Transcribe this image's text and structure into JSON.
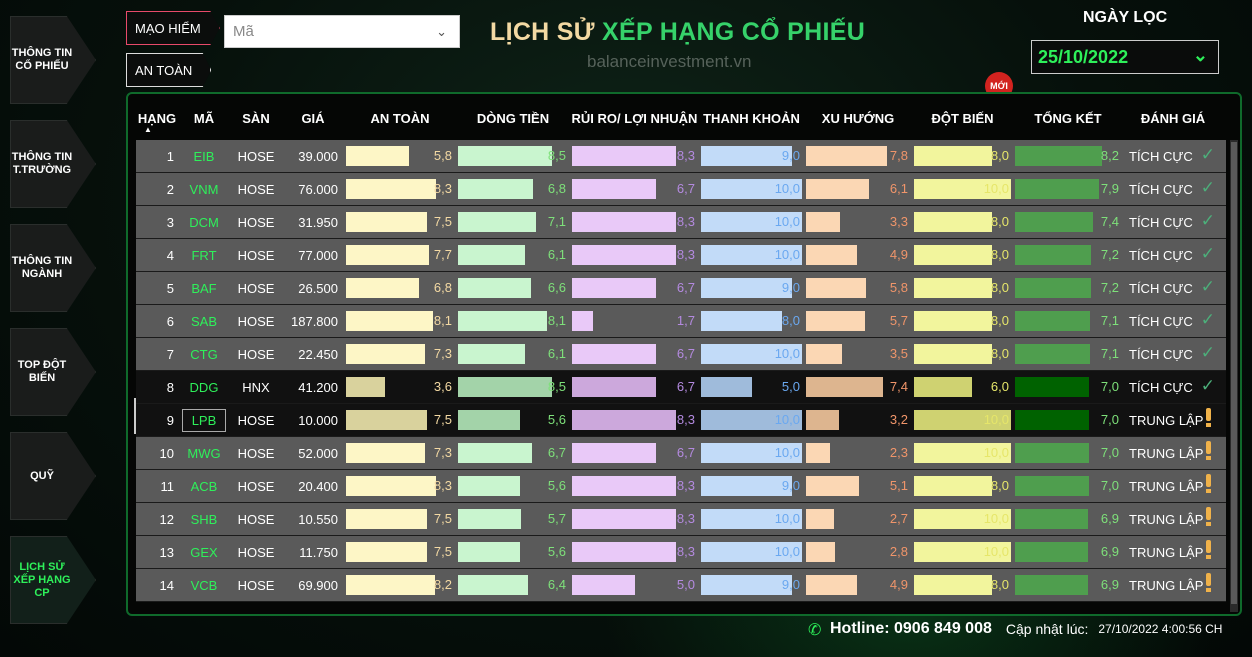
{
  "sidebar": {
    "items": [
      {
        "label": "THÔNG TIN CỔ PHIẾU",
        "active": false
      },
      {
        "label": "THÔNG TIN T.TRƯỜNG",
        "active": false
      },
      {
        "label": "THÔNG TIN NGÀNH",
        "active": false
      },
      {
        "label": "TOP ĐỘT BIẾN",
        "active": false
      },
      {
        "label": "QUỸ",
        "active": false
      },
      {
        "label": "LỊCH SỬ XẾP HẠNG CP",
        "active": true
      }
    ]
  },
  "filters": {
    "risk_chip": "MẠO HIỂM",
    "safe_chip": "AN TOÀN",
    "code_select": {
      "placeholder": "Mã",
      "value": ""
    }
  },
  "header": {
    "title_part1": "LỊCH SỬ ",
    "title_part2": "XẾP HẠNG CỔ PHIẾU",
    "watermark": "balanceinvestment.vn",
    "date_label": "NGÀY LỌC",
    "date_value": "25/10/2022",
    "new_badge": "MỚI"
  },
  "table": {
    "headers": {
      "rank": "HẠNG",
      "code": "MÃ",
      "exchange": "SÀN",
      "price": "GIÁ",
      "safety": "AN TOÀN",
      "cashflow": "DÒNG TIỀN",
      "risk_return": "RỦI RO/ LỢI NHUẬN",
      "liquidity": "THANH KHOẢN",
      "trend": "XU HƯỚNG",
      "breakout": "ĐỘT BIẾN",
      "total": "TỔNG KẾT",
      "rating": "ĐÁNH GIÁ"
    },
    "rows": [
      {
        "rank": "1",
        "code": "EIB",
        "exchange": "HOSE",
        "price": "39.000",
        "safety": "5,8",
        "cashflow": "8,5",
        "risk_return": "8,3",
        "liquidity": "9,0",
        "trend": "7,8",
        "breakout": "8,0",
        "total": "8,2",
        "rating": "TÍCH CỰC",
        "rating_icon": "check-icon"
      },
      {
        "rank": "2",
        "code": "VNM",
        "exchange": "HOSE",
        "price": "76.000",
        "safety": "8,3",
        "cashflow": "6,8",
        "risk_return": "6,7",
        "liquidity": "10,0",
        "trend": "6,1",
        "breakout": "10,0",
        "total": "7,9",
        "rating": "TÍCH CỰC",
        "rating_icon": "check-icon"
      },
      {
        "rank": "3",
        "code": "DCM",
        "exchange": "HOSE",
        "price": "31.950",
        "safety": "7,5",
        "cashflow": "7,1",
        "risk_return": "8,3",
        "liquidity": "10,0",
        "trend": "3,3",
        "breakout": "8,0",
        "total": "7,4",
        "rating": "TÍCH CỰC",
        "rating_icon": "check-icon"
      },
      {
        "rank": "4",
        "code": "FRT",
        "exchange": "HOSE",
        "price": "77.000",
        "safety": "7,7",
        "cashflow": "6,1",
        "risk_return": "8,3",
        "liquidity": "10,0",
        "trend": "4,9",
        "breakout": "8,0",
        "total": "7,2",
        "rating": "TÍCH CỰC",
        "rating_icon": "check-icon"
      },
      {
        "rank": "5",
        "code": "BAF",
        "exchange": "HOSE",
        "price": "26.500",
        "safety": "6,8",
        "cashflow": "6,6",
        "risk_return": "6,7",
        "liquidity": "9,0",
        "trend": "5,8",
        "breakout": "8,0",
        "total": "7,2",
        "rating": "TÍCH CỰC",
        "rating_icon": "check-icon"
      },
      {
        "rank": "6",
        "code": "SAB",
        "exchange": "HOSE",
        "price": "187.800",
        "safety": "8,1",
        "cashflow": "8,1",
        "risk_return": "1,7",
        "liquidity": "8,0",
        "trend": "5,7",
        "breakout": "8,0",
        "total": "7,1",
        "rating": "TÍCH CỰC",
        "rating_icon": "check-icon"
      },
      {
        "rank": "7",
        "code": "CTG",
        "exchange": "HOSE",
        "price": "22.450",
        "safety": "7,3",
        "cashflow": "6,1",
        "risk_return": "6,7",
        "liquidity": "10,0",
        "trend": "3,5",
        "breakout": "8,0",
        "total": "7,1",
        "rating": "TÍCH CỰC",
        "rating_icon": "check-icon"
      },
      {
        "rank": "8",
        "code": "DDG",
        "exchange": "HNX",
        "price": "41.200",
        "safety": "3,6",
        "cashflow": "8,5",
        "risk_return": "6,7",
        "liquidity": "5,0",
        "trend": "7,4",
        "breakout": "6,0",
        "total": "7,0",
        "rating": "TÍCH CỰC",
        "rating_icon": "check-icon"
      },
      {
        "rank": "9",
        "code": "LPB",
        "exchange": "HOSE",
        "price": "10.000",
        "safety": "7,5",
        "cashflow": "5,6",
        "risk_return": "8,3",
        "liquidity": "10,0",
        "trend": "3,2",
        "breakout": "10,0",
        "total": "7,0",
        "rating": "TRUNG LẬP",
        "rating_icon": "exclamation-icon"
      },
      {
        "rank": "10",
        "code": "MWG",
        "exchange": "HOSE",
        "price": "52.000",
        "safety": "7,3",
        "cashflow": "6,7",
        "risk_return": "6,7",
        "liquidity": "10,0",
        "trend": "2,3",
        "breakout": "10,0",
        "total": "7,0",
        "rating": "TRUNG LẬP",
        "rating_icon": "exclamation-icon"
      },
      {
        "rank": "11",
        "code": "ACB",
        "exchange": "HOSE",
        "price": "20.400",
        "safety": "8,3",
        "cashflow": "5,6",
        "risk_return": "8,3",
        "liquidity": "9,0",
        "trend": "5,1",
        "breakout": "8,0",
        "total": "7,0",
        "rating": "TRUNG LẬP",
        "rating_icon": "exclamation-icon"
      },
      {
        "rank": "12",
        "code": "SHB",
        "exchange": "HOSE",
        "price": "10.550",
        "safety": "7,5",
        "cashflow": "5,7",
        "risk_return": "8,3",
        "liquidity": "10,0",
        "trend": "2,7",
        "breakout": "10,0",
        "total": "6,9",
        "rating": "TRUNG LẬP",
        "rating_icon": "exclamation-icon"
      },
      {
        "rank": "13",
        "code": "GEX",
        "exchange": "HOSE",
        "price": "11.750",
        "safety": "7,5",
        "cashflow": "5,6",
        "risk_return": "8,3",
        "liquidity": "10,0",
        "trend": "2,8",
        "breakout": "10,0",
        "total": "6,9",
        "rating": "TRUNG LẬP",
        "rating_icon": "exclamation-icon"
      },
      {
        "rank": "14",
        "code": "VCB",
        "exchange": "HOSE",
        "price": "69.900",
        "safety": "8,2",
        "cashflow": "6,4",
        "risk_return": "5,0",
        "liquidity": "9,0",
        "trend": "4,9",
        "breakout": "8,0",
        "total": "6,9",
        "rating": "TRUNG LẬP",
        "rating_icon": "exclamation-icon"
      }
    ],
    "highlighted_row": 8,
    "selected_code_row": 9
  },
  "colors": {
    "safety_bar": "#fdf6c6",
    "cashflow_bar": "#c9f5cf",
    "risk_bar": "#e9c9f8",
    "liquidity_bar": "#c2dbf8",
    "trend_bar": "#fbd7b4",
    "breakout_bar": "#f2f59d",
    "total_bar": "#4f9e4e",
    "safety_text": "#f3d9a3",
    "cashflow_text": "#7ee07a",
    "risk_text": "#b48ae0",
    "liquidity_text": "#6aa8f0",
    "trend_text": "#f0956a",
    "breakout_text": "#e6e66a",
    "total_text": "#7ee07a"
  },
  "footer": {
    "hotline": "Hotline: 0906 849 008",
    "update_label": "Cập nhật lúc:",
    "update_value": "27/10/2022 4:00:56 CH"
  }
}
